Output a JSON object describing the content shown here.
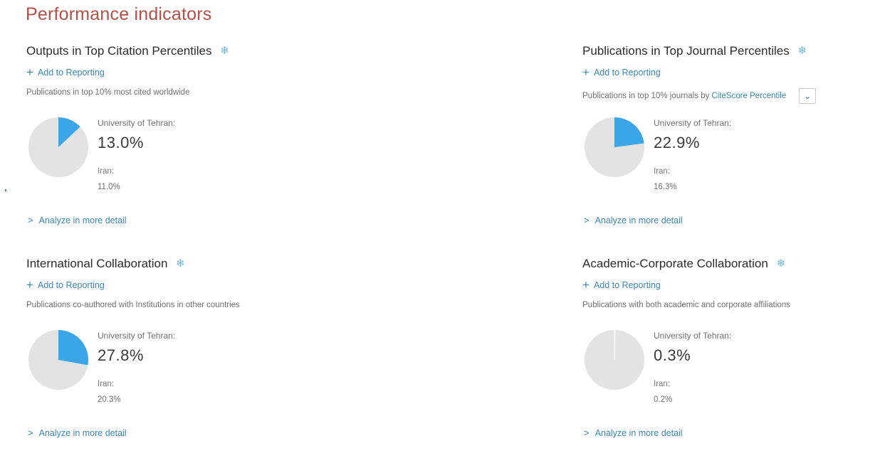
{
  "page": {
    "title": "Performance indicators"
  },
  "colors": {
    "accent": "#3aa6e8",
    "pie_rest": "#e3e3e3",
    "title": "#b0514a",
    "link": "#3a86b4"
  },
  "icons": {
    "gear": "gear-icon",
    "plus": "plus-icon",
    "chevron_right": "chevron-right-icon",
    "chevron_down": "chevron-down-icon"
  },
  "cards": [
    {
      "title": "Outputs in Top Citation Percentiles",
      "add_label": "Add to Reporting",
      "description": "Publications in top 10% most cited worldwide",
      "org_label": "University of Tehran:",
      "org_value": "13.0%",
      "org_fraction": 0.13,
      "country_label": "Iran:",
      "country_value": "11.0%",
      "analyze_label": "Analyze in more detail"
    },
    {
      "title": "Publications in Top Journal Percentiles",
      "add_label": "Add to Reporting",
      "description": "Publications in top 10% journals by",
      "metric_link": "CiteScore Percentile",
      "org_label": "University of Tehran:",
      "org_value": "22.9%",
      "org_fraction": 0.229,
      "country_label": "Iran:",
      "country_value": "16.3%",
      "analyze_label": "Analyze in more detail"
    },
    {
      "title": "International Collaboration",
      "add_label": "Add to Reporting",
      "description": "Publications co-authored with Institutions in other countries",
      "org_label": "University of Tehran:",
      "org_value": "27.8%",
      "org_fraction": 0.278,
      "country_label": "Iran:",
      "country_value": "20.3%",
      "analyze_label": "Analyze in more detail"
    },
    {
      "title": "Academic-Corporate Collaboration",
      "add_label": "Add to Reporting",
      "description": "Publications with both academic and corporate affiliations",
      "org_label": "University of Tehran:",
      "org_value": "0.3%",
      "org_fraction": 0.003,
      "country_label": "Iran:",
      "country_value": "0.2%",
      "analyze_label": "Analyze in more detail"
    }
  ]
}
